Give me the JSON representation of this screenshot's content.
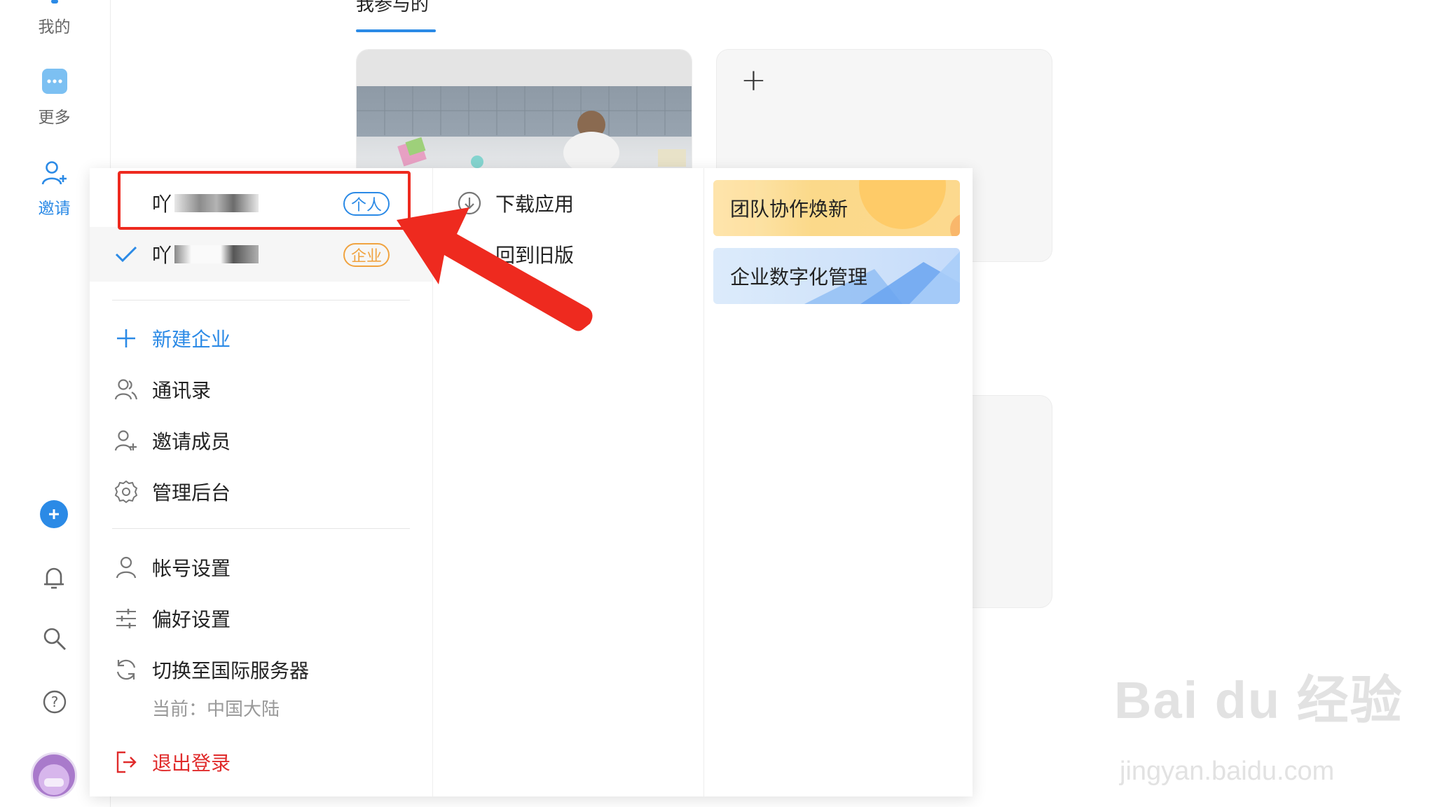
{
  "sidebar": {
    "mine_label": "我的",
    "more_label": "更多",
    "invite_label": "邀请"
  },
  "main": {
    "tab_participated": "我参与的",
    "add_card_symbol": "+"
  },
  "account_menu": {
    "accounts": [
      {
        "name_visible": "吖",
        "type_badge": "个人",
        "selected": false
      },
      {
        "name_visible": "吖",
        "type_badge": "企业",
        "selected": true
      }
    ],
    "new_enterprise": "新建企业",
    "contacts": "通讯录",
    "invite_members": "邀请成员",
    "admin_console": "管理后台",
    "account_settings": "帐号设置",
    "preferences": "偏好设置",
    "switch_server": "切换至国际服务器",
    "current_server": "当前：中国大陆",
    "logout": "退出登录"
  },
  "middle_menu": {
    "download_app": "下载应用",
    "old_version": "回到旧版"
  },
  "promos": {
    "team_collab": "团队协作焕新",
    "enterprise_digital": "企业数字化管理"
  },
  "watermark": {
    "brand": "Bai du 经验",
    "url": "jingyan.baidu.com"
  },
  "colors": {
    "accent_blue": "#2b8ae6",
    "enterprise_orange": "#f0a340",
    "logout_red": "#e02b2b",
    "annotation_red": "#ee2a1f"
  }
}
